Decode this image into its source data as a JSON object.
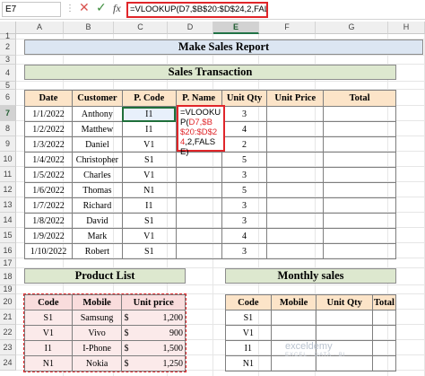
{
  "formula_bar": {
    "name_box": "E7",
    "cancel_icon": "✕",
    "enter_icon": "✓",
    "fx_label": "fx",
    "formula": "=VLOOKUP(D7,$B$20:$D$24,2,FALSE)"
  },
  "columns": [
    "A",
    "B",
    "C",
    "D",
    "E",
    "F",
    "G",
    "H"
  ],
  "rows": [
    "1",
    "2",
    "3",
    "4",
    "5",
    "6",
    "7",
    "8",
    "9",
    "10",
    "11",
    "12",
    "13",
    "14",
    "15",
    "16",
    "17",
    "18",
    "19",
    "20",
    "21",
    "22",
    "23",
    "24"
  ],
  "titles": {
    "main": "Make Sales Report",
    "transaction": "Sales Transaction",
    "product_list": "Product List",
    "monthly": "Monthly sales"
  },
  "sales_table": {
    "headers": [
      "Date",
      "Customer",
      "P. Code",
      "P. Name",
      "Unit Qty",
      "Unit Price",
      "Total"
    ],
    "rows": [
      {
        "date": "1/1/2022",
        "customer": "Anthony",
        "code": "I1",
        "qty": "3"
      },
      {
        "date": "1/2/2022",
        "customer": "Matthew",
        "code": "I1",
        "qty": "4"
      },
      {
        "date": "1/3/2022",
        "customer": "Daniel",
        "code": "V1",
        "qty": "2"
      },
      {
        "date": "1/4/2022",
        "customer": "Christopher",
        "code": "S1",
        "qty": "5"
      },
      {
        "date": "1/5/2022",
        "customer": "Charles",
        "code": "V1",
        "qty": "3"
      },
      {
        "date": "1/6/2022",
        "customer": "Thomas",
        "code": "N1",
        "qty": "5"
      },
      {
        "date": "1/7/2022",
        "customer": "Richard",
        "code": "I1",
        "qty": "3"
      },
      {
        "date": "1/8/2022",
        "customer": "David",
        "code": "S1",
        "qty": "3"
      },
      {
        "date": "1/9/2022",
        "customer": "Mark",
        "code": "V1",
        "qty": "4"
      },
      {
        "date": "1/10/2022",
        "customer": "Robert",
        "code": "S1",
        "qty": "3"
      }
    ],
    "edit_text": {
      "part1": "=VLOOKUP(",
      "part2": "D7,",
      "part3": "$B$20:$",
      "part4": "D$24",
      "part5": ",2,FAL",
      "part6": "SE)"
    }
  },
  "product_table": {
    "headers": [
      "Code",
      "Mobile",
      "Unit price"
    ],
    "rows": [
      {
        "code": "S1",
        "mobile": "Samsung",
        "cur": "$",
        "price": "1,200"
      },
      {
        "code": "V1",
        "mobile": "Vivo",
        "cur": "$",
        "price": "900"
      },
      {
        "code": "I1",
        "mobile": "I-Phone",
        "cur": "$",
        "price": "1,500"
      },
      {
        "code": "N1",
        "mobile": "Nokia",
        "cur": "$",
        "price": "1,250"
      }
    ]
  },
  "monthly_table": {
    "headers": [
      "Code",
      "Mobile",
      "Unit Qty",
      "Total"
    ],
    "rows": [
      {
        "code": "S1"
      },
      {
        "code": "V1"
      },
      {
        "code": "I1"
      },
      {
        "code": "N1"
      }
    ]
  },
  "watermark": {
    "name": "exceldemy",
    "tagline": "EXCEL · DATA · BI"
  },
  "colors": {
    "title_fill": "#dce6f2",
    "header_fill": "#fce4c8",
    "product_fill": "#f9dcdc",
    "selection": "#1f6f3a",
    "edit_border": "#e0262a"
  }
}
